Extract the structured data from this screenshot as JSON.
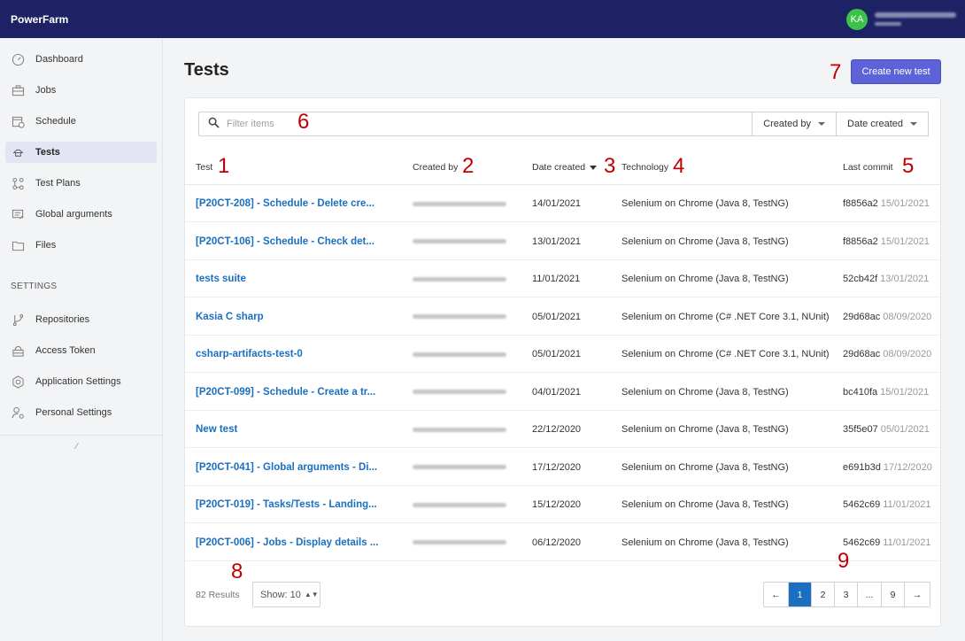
{
  "app": {
    "brand": "PowerFarm",
    "user_initials": "KA"
  },
  "sidebar": {
    "items": [
      {
        "label": "Dashboard",
        "icon": "gauge-icon"
      },
      {
        "label": "Jobs",
        "icon": "briefcase-icon"
      },
      {
        "label": "Schedule",
        "icon": "calendar-icon"
      },
      {
        "label": "Tests",
        "icon": "flask-icon",
        "active": true
      },
      {
        "label": "Test Plans",
        "icon": "flow-icon"
      },
      {
        "label": "Global arguments",
        "icon": "args-icon"
      },
      {
        "label": "Files",
        "icon": "folder-icon"
      }
    ],
    "settings_title": "SETTINGS",
    "settings_items": [
      {
        "label": "Repositories",
        "icon": "branch-icon"
      },
      {
        "label": "Access Token",
        "icon": "lock-icon"
      },
      {
        "label": "Application Settings",
        "icon": "gear-icon"
      },
      {
        "label": "Personal Settings",
        "icon": "user-gear-icon"
      }
    ]
  },
  "page": {
    "title": "Tests",
    "create_button": "Create new test"
  },
  "filter": {
    "placeholder": "Filter items",
    "created_by": "Created by",
    "date_created": "Date created"
  },
  "table": {
    "headers": {
      "test": "Test",
      "created_by": "Created by",
      "date_created": "Date created",
      "technology": "Technology",
      "last_commit": "Last commit"
    },
    "rows": [
      {
        "test": "[P20CT-208] - Schedule - Delete cre...",
        "date": "14/01/2021",
        "tech": "Selenium on Chrome (Java 8, TestNG)",
        "hash": "f8856a2",
        "commit_date": "15/01/2021"
      },
      {
        "test": "[P20CT-106] - Schedule - Check det...",
        "date": "13/01/2021",
        "tech": "Selenium on Chrome (Java 8, TestNG)",
        "hash": "f8856a2",
        "commit_date": "15/01/2021"
      },
      {
        "test": "tests suite",
        "date": "11/01/2021",
        "tech": "Selenium on Chrome (Java 8, TestNG)",
        "hash": "52cb42f",
        "commit_date": "13/01/2021"
      },
      {
        "test": "Kasia C sharp",
        "date": "05/01/2021",
        "tech": "Selenium on Chrome (C# .NET Core 3.1, NUnit)",
        "hash": "29d68ac",
        "commit_date": "08/09/2020"
      },
      {
        "test": "csharp-artifacts-test-0",
        "date": "05/01/2021",
        "tech": "Selenium on Chrome (C# .NET Core 3.1, NUnit)",
        "hash": "29d68ac",
        "commit_date": "08/09/2020"
      },
      {
        "test": "[P20CT-099] - Schedule - Create a tr...",
        "date": "04/01/2021",
        "tech": "Selenium on Chrome (Java 8, TestNG)",
        "hash": "bc410fa",
        "commit_date": "15/01/2021"
      },
      {
        "test": "New test",
        "date": "22/12/2020",
        "tech": "Selenium on Chrome (Java 8, TestNG)",
        "hash": "35f5e07",
        "commit_date": "05/01/2021"
      },
      {
        "test": "[P20CT-041] - Global arguments - Di...",
        "date": "17/12/2020",
        "tech": "Selenium on Chrome (Java 8, TestNG)",
        "hash": "e691b3d",
        "commit_date": "17/12/2020"
      },
      {
        "test": "[P20CT-019] - Tasks/Tests - Landing...",
        "date": "15/12/2020",
        "tech": "Selenium on Chrome (Java 8, TestNG)",
        "hash": "5462c69",
        "commit_date": "11/01/2021"
      },
      {
        "test": "[P20CT-006] - Jobs - Display details ...",
        "date": "06/12/2020",
        "tech": "Selenium on Chrome (Java 8, TestNG)",
        "hash": "5462c69",
        "commit_date": "11/01/2021"
      }
    ]
  },
  "footer": {
    "results": "82 Results",
    "show_label": "Show: 10",
    "pages": [
      "1",
      "2",
      "3",
      "...",
      "9"
    ],
    "prev": "←",
    "next": "→"
  },
  "annotations": [
    "1",
    "2",
    "3",
    "4",
    "5",
    "6",
    "7",
    "8",
    "9"
  ]
}
